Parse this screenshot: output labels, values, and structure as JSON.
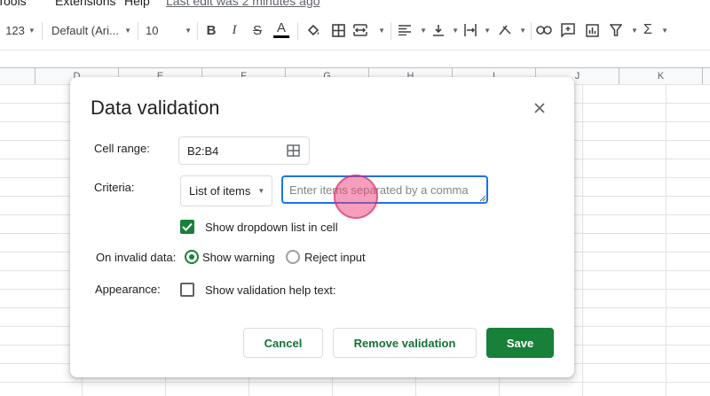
{
  "menu": {
    "tools": "Tools",
    "extensions": "Extensions",
    "help": "Help",
    "last_edit": "Last edit was 2 minutes ago"
  },
  "toolbar": {
    "number_format": "123",
    "font": "Default (Ari...",
    "font_size": "10",
    "icons": [
      "bold-icon",
      "italic-icon",
      "strikethrough-icon",
      "text-color-icon",
      "fill-color-icon",
      "borders-icon",
      "merge-cells-icon",
      "horizontal-align-icon",
      "vertical-align-icon",
      "text-wrap-icon",
      "text-rotation-icon",
      "link-icon",
      "comment-icon",
      "chart-icon",
      "filter-icon",
      "functions-icon"
    ]
  },
  "columns": [
    "D",
    "E",
    "F",
    "G",
    "H",
    "I",
    "J",
    "K"
  ],
  "dialog": {
    "title": "Data validation",
    "cell_range_label": "Cell range:",
    "cell_range_value": "B2:B4",
    "criteria_label": "Criteria:",
    "criteria_value": "List of items",
    "items_placeholder": "Enter items separated by a comma",
    "items_value": "",
    "show_dropdown_label": "Show dropdown list in cell",
    "show_dropdown_checked": true,
    "invalid_label": "On invalid data:",
    "show_warning_label": "Show warning",
    "reject_input_label": "Reject input",
    "invalid_selected": "show_warning",
    "appearance_label": "Appearance:",
    "help_text_label": "Show validation help text:",
    "help_text_checked": false,
    "cancel_label": "Cancel",
    "remove_label": "Remove validation",
    "save_label": "Save"
  },
  "colors": {
    "accent_green": "#188038",
    "focus_blue": "#1a73e8"
  }
}
